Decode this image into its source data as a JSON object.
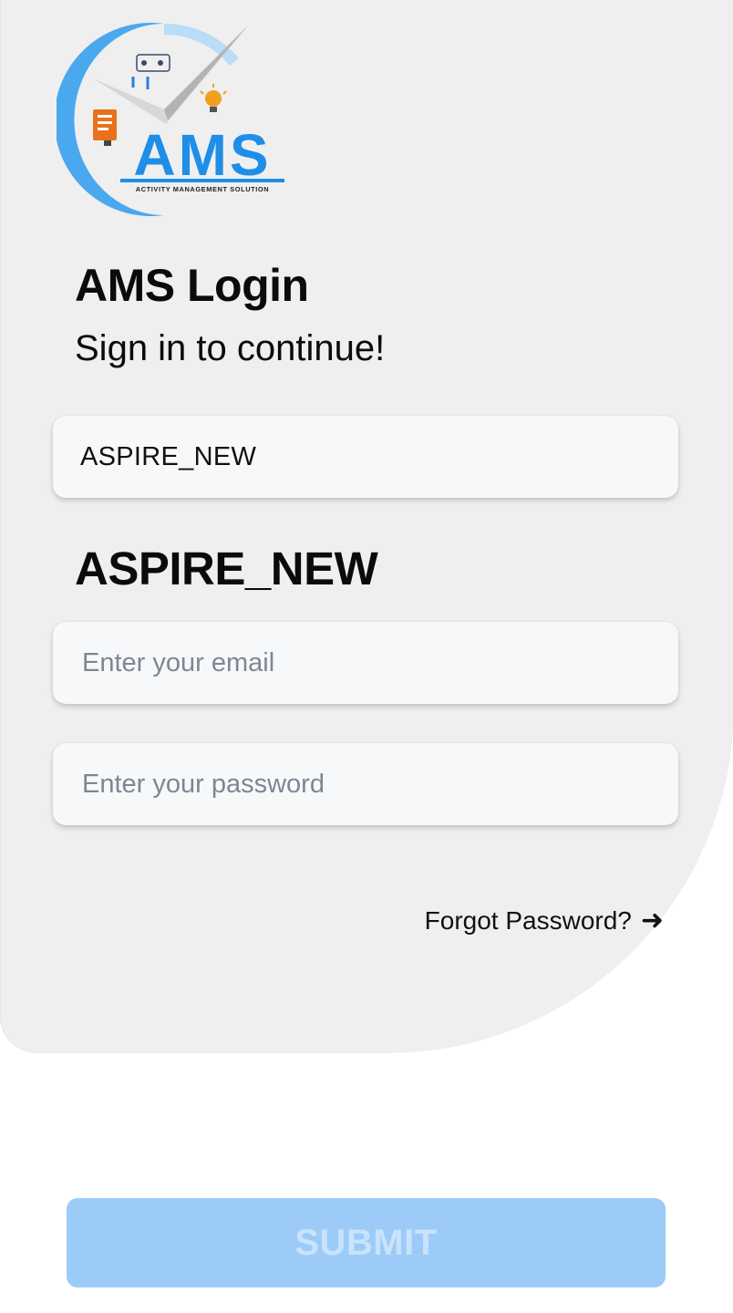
{
  "logo": {
    "brand": "AMS",
    "tagline": "ACTIVITY MANAGEMENT SOLUTION"
  },
  "header": {
    "title": "AMS Login",
    "subtitle": "Sign in to continue!"
  },
  "organization": {
    "field_value": "ASPIRE_NEW",
    "heading": "ASPIRE_NEW"
  },
  "form": {
    "email_placeholder": "Enter your email",
    "password_placeholder": "Enter your password",
    "forgot_label": "Forgot Password?",
    "forgot_icon": "arrow-right-icon"
  },
  "submit": {
    "label": "SUBMIT",
    "state": "disabled"
  },
  "colors": {
    "brand_blue": "#1f8ee8",
    "card_background": "#efefef",
    "submit_background": "#9ccbf8"
  }
}
